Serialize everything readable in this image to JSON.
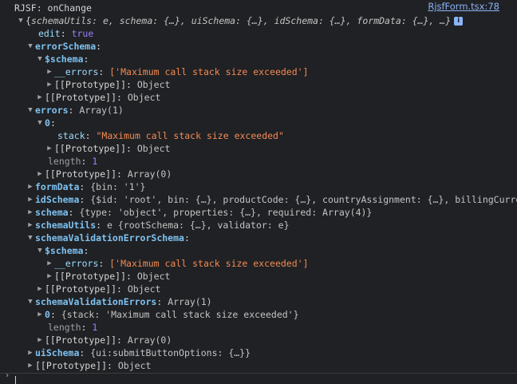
{
  "log": {
    "label": "RJSF: onChange",
    "source": "RjsfForm.tsx:78",
    "summary_prefix": "{",
    "summary_content": "schemaUtils: e, schema: {…}, uiSchema: {…}, idSchema: {…}, formData: {…}, …}",
    "info_badge": "i"
  },
  "tree": {
    "edit_key": "edit",
    "edit_val": "true",
    "errorSchema_key": "errorSchema",
    "schema_key": "$schema",
    "errors_key": "__errors",
    "errors_val": "['Maximum call stack size exceeded']",
    "proto_key": "[[Prototype]]",
    "proto_object": "Object",
    "errors2_key": "errors",
    "errors2_val": "Array(1)",
    "zero_key": "0",
    "stack_key": "stack",
    "stack_val": "\"Maximum call stack size exceeded\"",
    "length_key": "length",
    "length_val": "1",
    "proto_array0": "Array(0)",
    "formData_key": "formData",
    "formData_val": "{bin: '1'}",
    "idSchema_key": "idSchema",
    "idSchema_val": "{$id: 'root', bin: {…}, productCode: {…}, countryAssignment: {…}, billingCurren",
    "schemaObj_key": "schema",
    "schemaObj_val": "{type: 'object', properties: {…}, required: Array(4)}",
    "schemaUtils_key": "schemaUtils",
    "schemaUtils_val": "e {rootSchema: {…}, validator: e}",
    "sves_key": "schemaValidationErrorSchema",
    "sve_key": "schemaValidationErrors",
    "sve_val": "Array(1)",
    "sve_zero_val": "{stack: 'Maximum call stack size exceeded'}",
    "uiSchema_key": "uiSchema",
    "uiSchema_val": "{ui:submitButtonOptions: {…}}"
  },
  "prompt": {
    "caret": "›"
  }
}
